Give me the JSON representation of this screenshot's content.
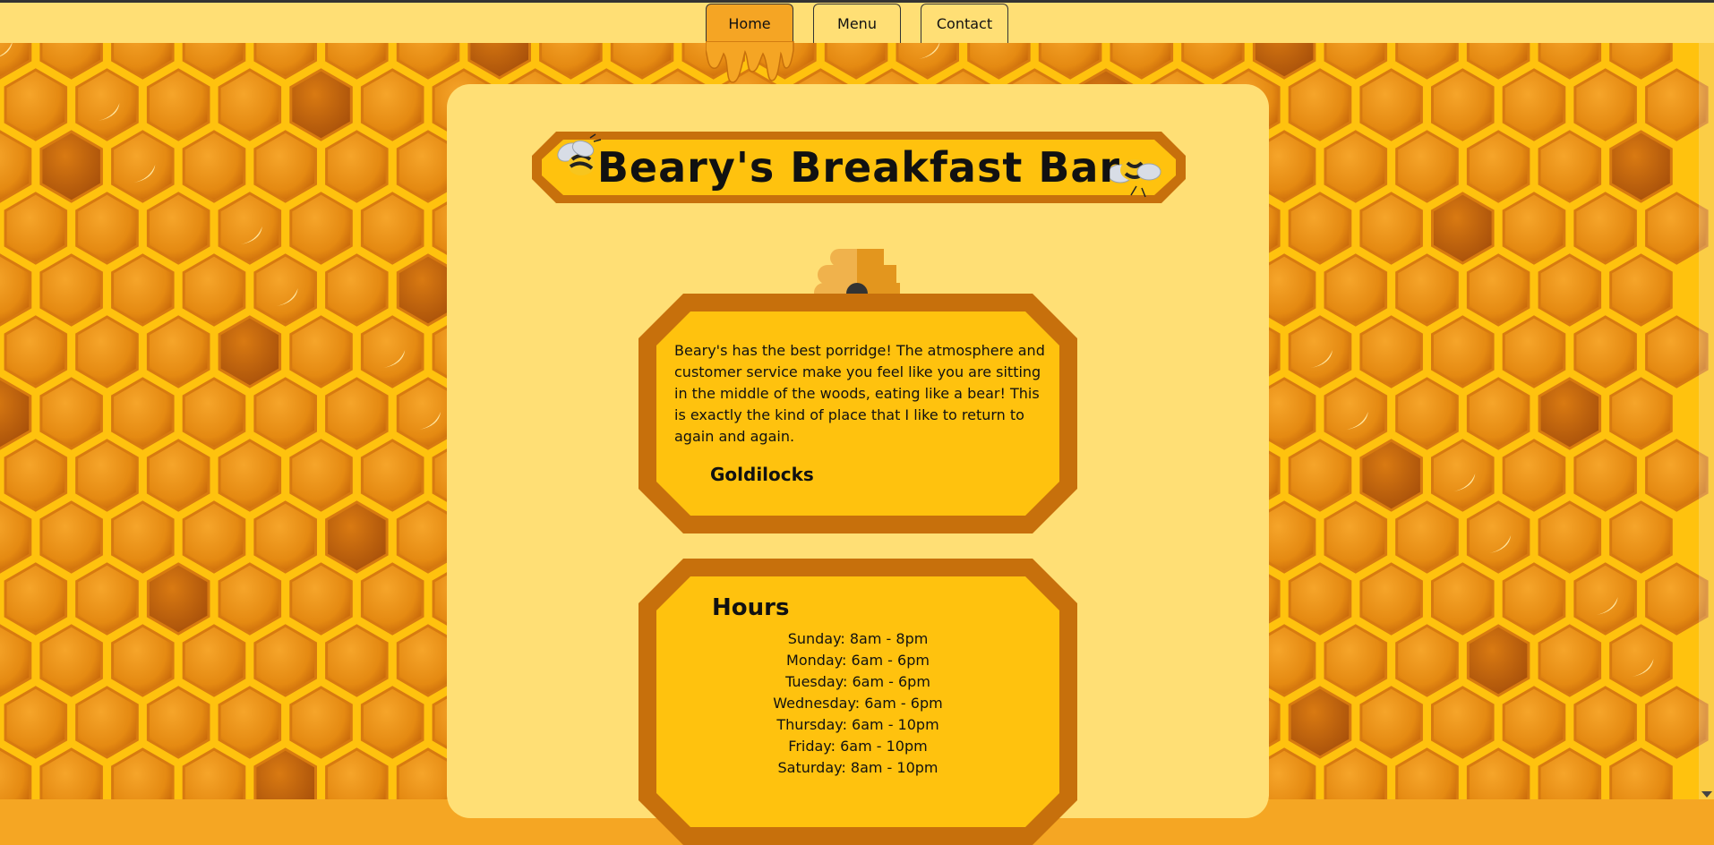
{
  "nav": {
    "tabs": [
      {
        "label": "Home",
        "active": true
      },
      {
        "label": "Menu",
        "active": false
      },
      {
        "label": "Contact",
        "active": false
      }
    ]
  },
  "banner": {
    "title": "Beary's Breakfast Bar"
  },
  "review": {
    "text": "Beary's has the best porridge! The atmosphere and customer service make you feel like you are sitting in the middle of the woods, eating like a bear! This is exactly the kind of place that I like to return to again and again.",
    "author": "Goldilocks"
  },
  "hours": {
    "title": "Hours",
    "items": [
      "Sunday: 8am - 8pm",
      "Monday: 6am - 6pm",
      "Tuesday: 6am - 6pm",
      "Wednesday: 6am - 6pm",
      "Thursday: 6am - 10pm",
      "Friday: 6am - 10pm",
      "Saturday: 8am - 10pm"
    ]
  },
  "colors": {
    "panel": "#ffdf75",
    "honey_light": "#ffc20e",
    "honey_dark": "#c7700c",
    "active_tab": "#f5a524"
  }
}
